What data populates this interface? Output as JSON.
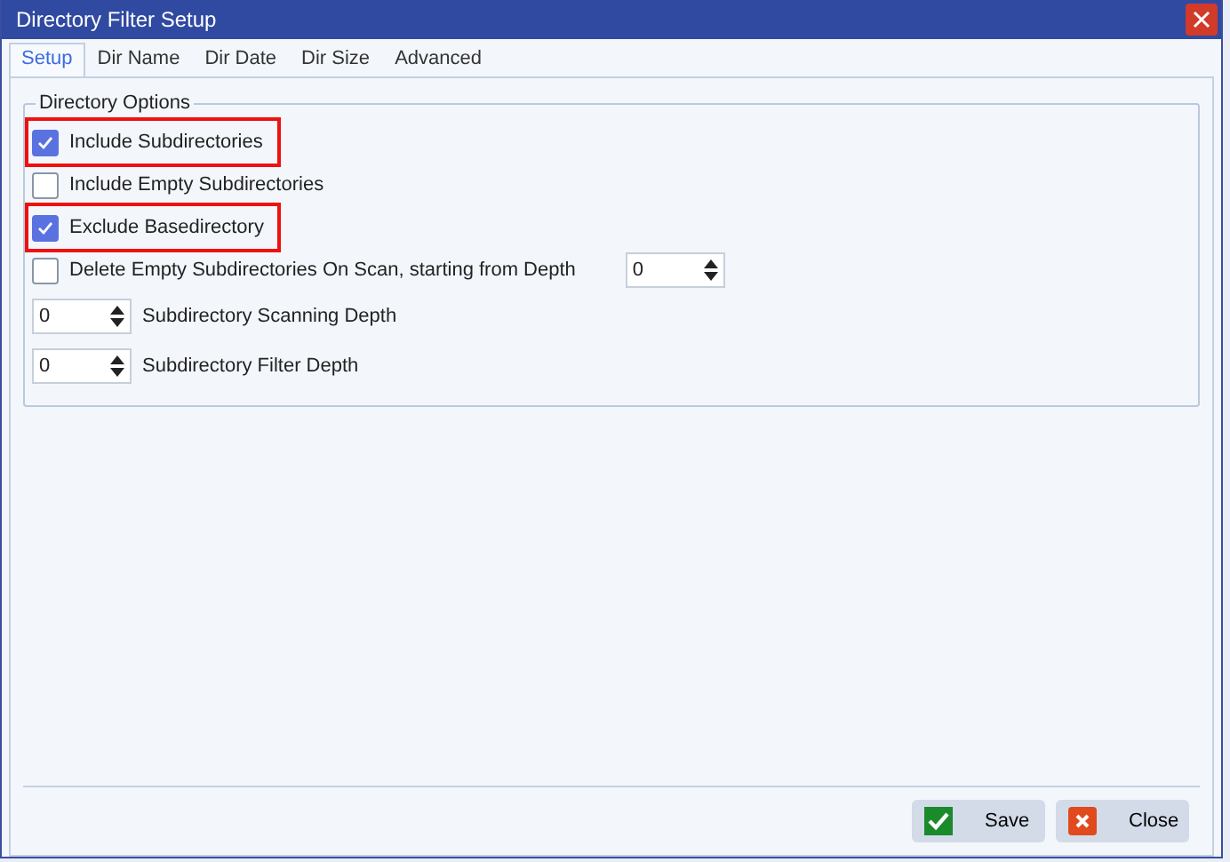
{
  "window": {
    "title": "Directory Filter Setup"
  },
  "tabs": [
    {
      "label": "Setup",
      "selected": true
    },
    {
      "label": "Dir Name",
      "selected": false
    },
    {
      "label": "Dir Date",
      "selected": false
    },
    {
      "label": "Dir Size",
      "selected": false
    },
    {
      "label": "Advanced",
      "selected": false
    }
  ],
  "group": {
    "title": "Directory Options",
    "options": [
      {
        "kind": "checkbox",
        "label": "Include Subdirectories",
        "checked": true,
        "highlighted": true
      },
      {
        "kind": "checkbox",
        "label": "Include Empty Subdirectories",
        "checked": false,
        "highlighted": false
      },
      {
        "kind": "checkbox",
        "label": "Exclude Basedirectory",
        "checked": true,
        "highlighted": true
      },
      {
        "kind": "checkbox_spin",
        "label": "Delete Empty Subdirectories On Scan, starting from Depth",
        "checked": false,
        "highlighted": false,
        "value": "0"
      },
      {
        "kind": "spin",
        "label": "Subdirectory Scanning Depth",
        "value": "0"
      },
      {
        "kind": "spin",
        "label": "Subdirectory Filter Depth",
        "value": "0"
      }
    ]
  },
  "buttons": [
    {
      "kind": "save",
      "label": "Save"
    },
    {
      "kind": "close",
      "label": "Close"
    }
  ]
}
